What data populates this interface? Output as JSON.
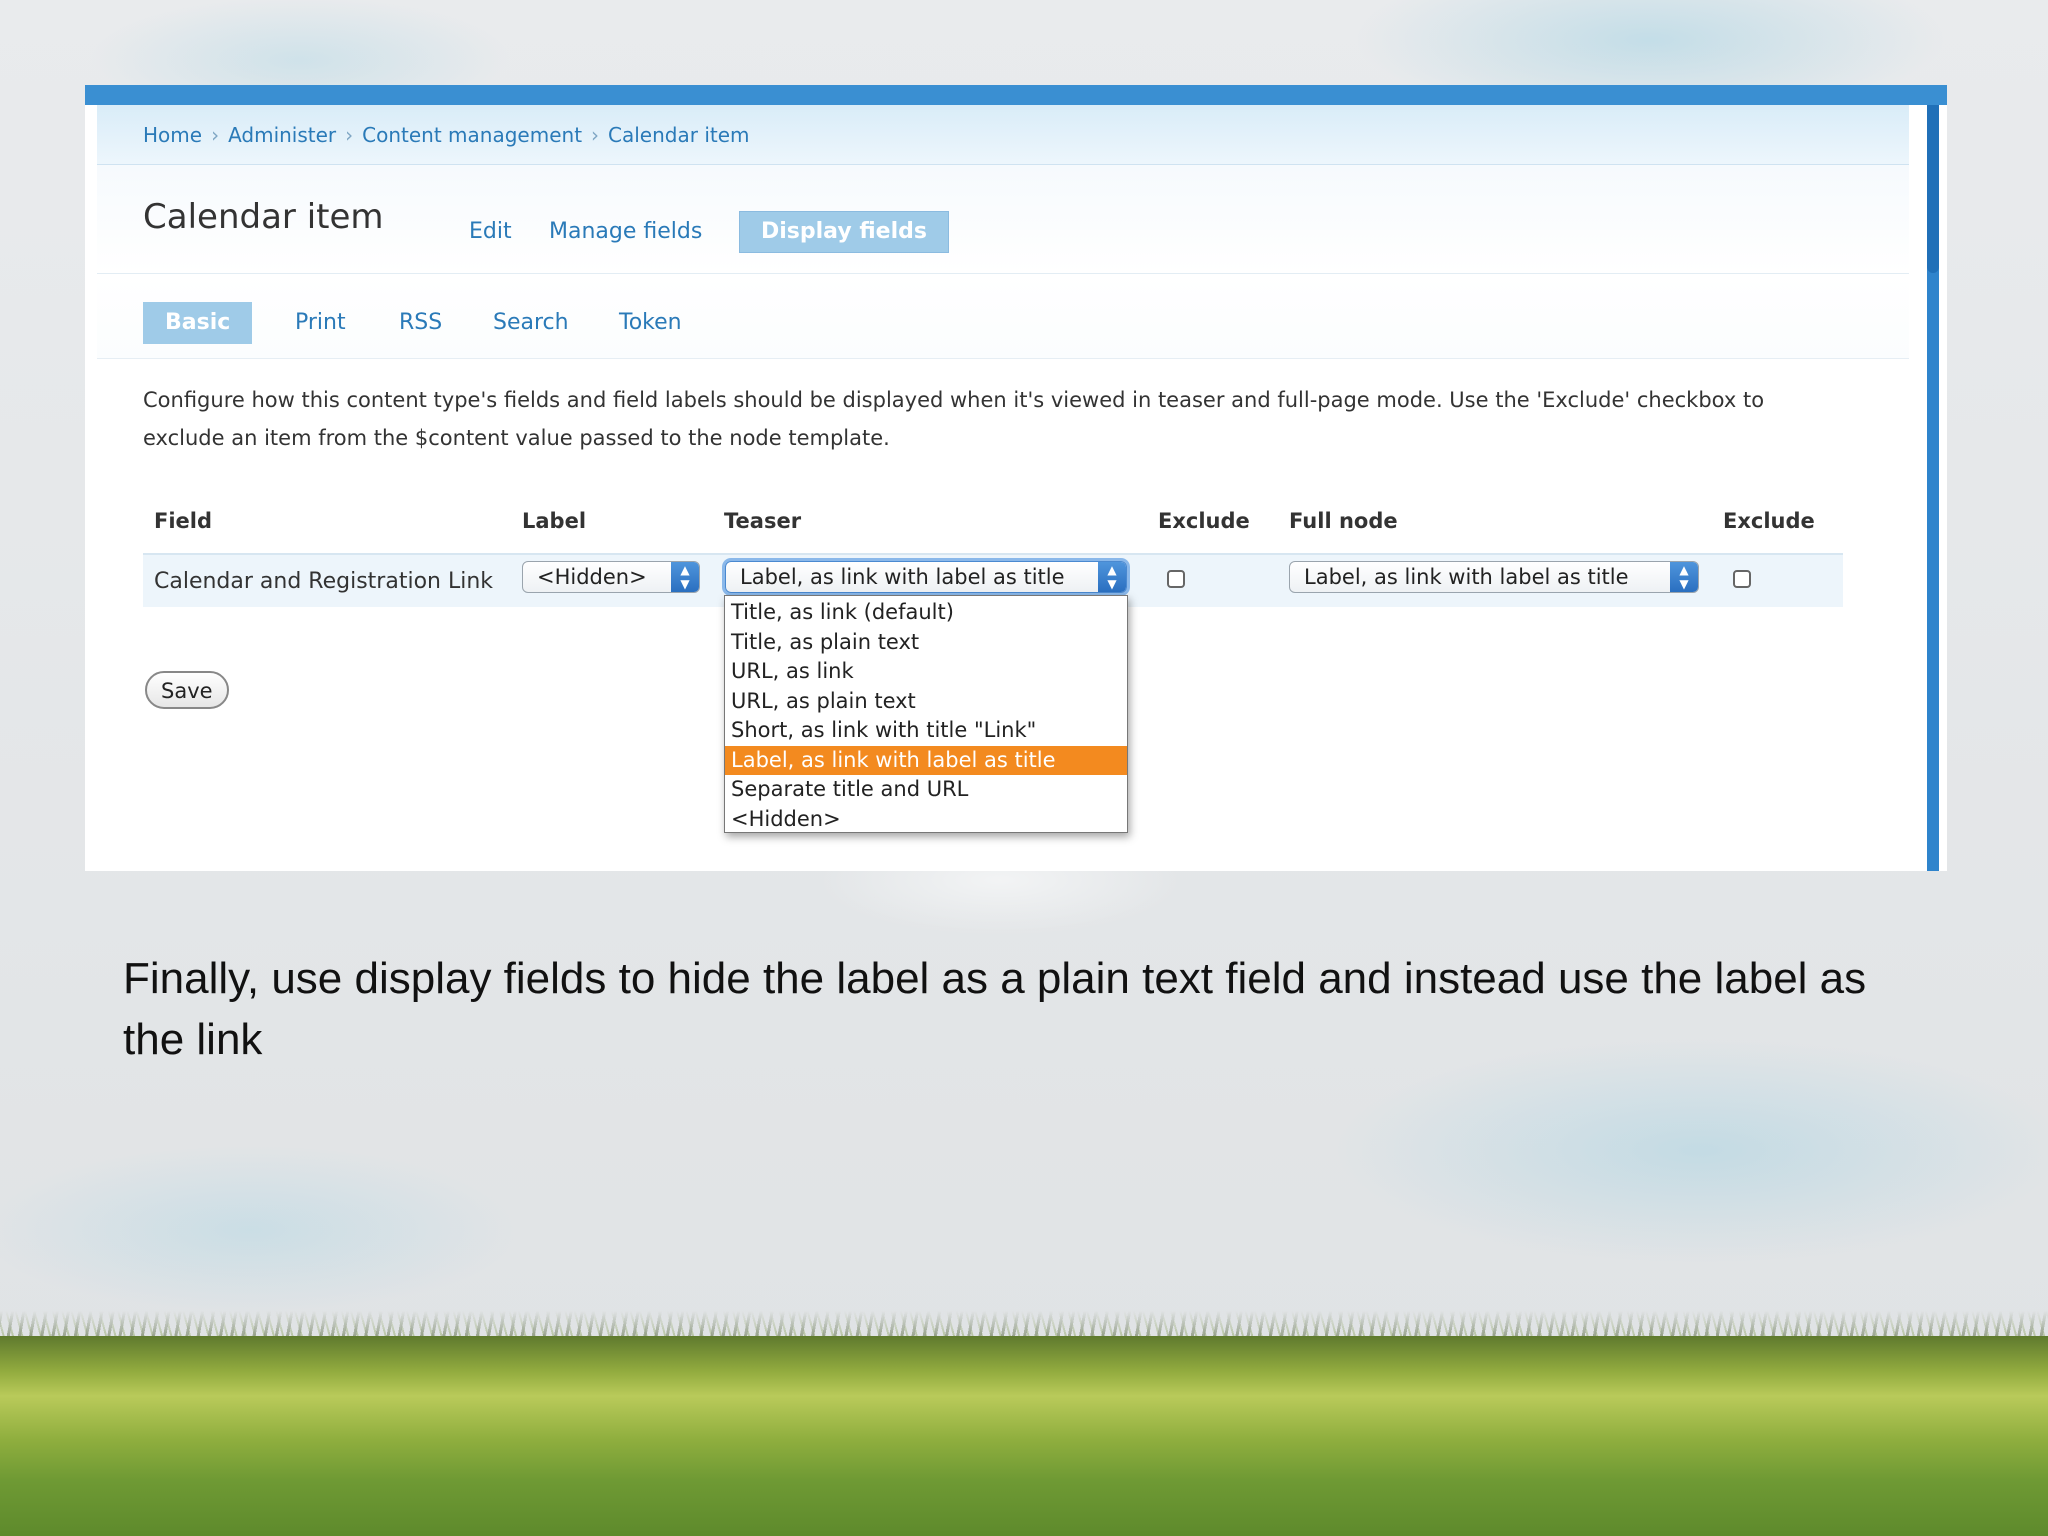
{
  "breadcrumb": [
    "Home",
    "Administer",
    "Content management",
    "Calendar item"
  ],
  "breadcrumb_sep": "›",
  "page_title": "Calendar item",
  "tabs": [
    {
      "label": "Edit",
      "active": false
    },
    {
      "label": "Manage fields",
      "active": false
    },
    {
      "label": "Display fields",
      "active": true
    }
  ],
  "subtabs": [
    {
      "label": "Basic",
      "active": true
    },
    {
      "label": "Print",
      "active": false
    },
    {
      "label": "RSS",
      "active": false
    },
    {
      "label": "Search",
      "active": false
    },
    {
      "label": "Token",
      "active": false
    }
  ],
  "description": "Configure how this content type's fields and field labels should be displayed when it's viewed in teaser and full-page mode. Use the 'Exclude' checkbox to exclude an item from the $content value passed to the node template.",
  "table": {
    "headers": [
      "Field",
      "Label",
      "Teaser",
      "Exclude",
      "Full node",
      "Exclude"
    ],
    "row": {
      "field": "Calendar and Registration Link",
      "label_value": "<Hidden>",
      "teaser_value": "Label, as link with label as title",
      "teaser_exclude": false,
      "full_value": "Label, as link with label as title",
      "full_exclude": false
    }
  },
  "dropdown_options": [
    "Title, as link (default)",
    "Title, as plain text",
    "URL, as link",
    "URL, as plain text",
    "Short, as link with title \"Link\"",
    "Label, as link with label as title",
    "Separate title and URL",
    "<Hidden>"
  ],
  "dropdown_selected_index": 5,
  "save_label": "Save",
  "caption": "Finally, use display fields to hide the label as a plain text field and instead use the label as the link",
  "colors": {
    "accent": "#3a8fd2",
    "link": "#2a7ab8",
    "active_tab": "#9fcbe8",
    "selected_option": "#f38a1f"
  }
}
